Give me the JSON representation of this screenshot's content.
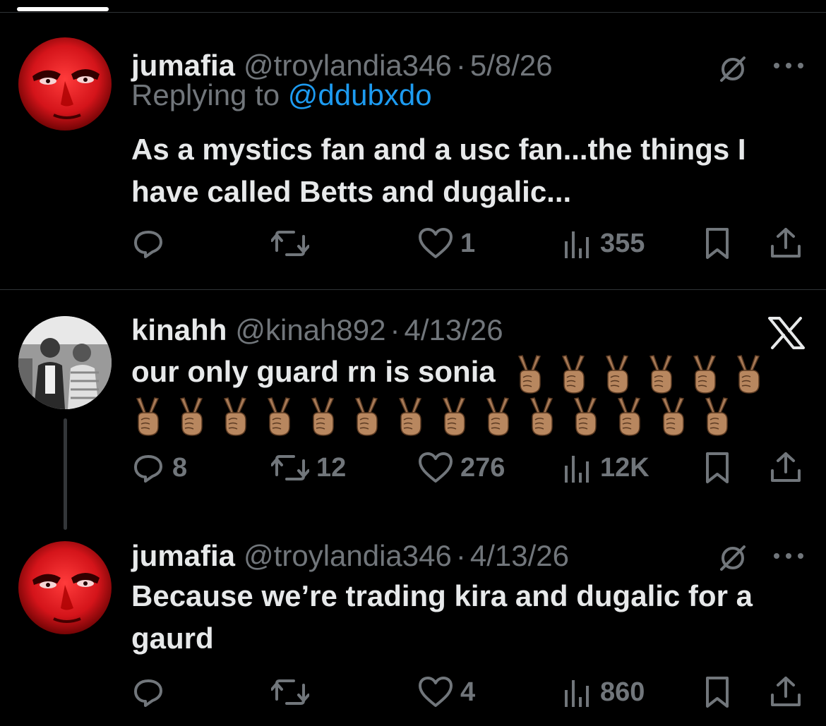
{
  "tweets": [
    {
      "name": "jumafia",
      "handle": "@troylandia346",
      "dot": "·",
      "date": "5/8/26",
      "replying_prefix": "Replying to",
      "replying_to": "@ddubxdo",
      "text": "As a mystics fan and a usc fan...the things I have called Betts and dugalic...",
      "corner_icon": "grok-icon",
      "actions": {
        "reply": "",
        "retweet": "",
        "like": "1",
        "views": "355"
      }
    },
    {
      "name": "kinahh",
      "handle": "@kinah892",
      "dot": "·",
      "date": "4/13/26",
      "text": "our only guard rn is sonia",
      "emoji_count_line1": 6,
      "emoji_count_line2": 14,
      "emoji_name": "victory-hand-medium-skin-tone",
      "corner_icon": "x-logo-icon",
      "actions": {
        "reply": "8",
        "retweet": "12",
        "like": "276",
        "views": "12K"
      }
    },
    {
      "name": "jumafia",
      "handle": "@troylandia346",
      "dot": "·",
      "date": "4/13/26",
      "text": "Because we’re trading kira and dugalic for a gaurd",
      "corner_icon": "grok-icon",
      "actions": {
        "reply": "",
        "retweet": "",
        "like": "4",
        "views": "860"
      }
    }
  ],
  "colors": {
    "background": "#000000",
    "text": "#e7e9ea",
    "muted": "#71767b",
    "link": "#1d9bf0",
    "divider": "#2f3336"
  }
}
